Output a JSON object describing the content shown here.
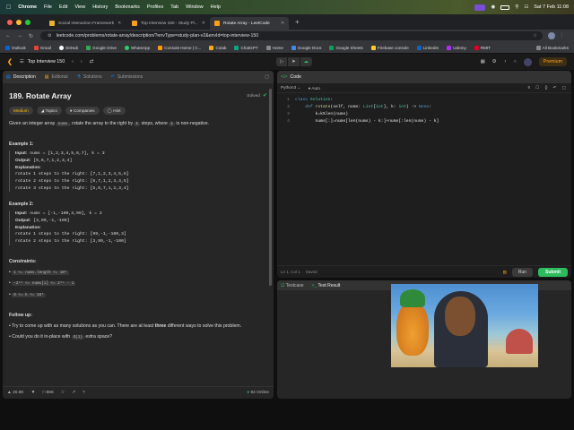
{
  "macos": {
    "menu": [
      "Chrome",
      "File",
      "Edit",
      "View",
      "History",
      "Bookmarks",
      "Profiles",
      "Tab",
      "Window",
      "Help"
    ],
    "datetime": "Sat 7 Feb  11:08"
  },
  "tabs": [
    {
      "label": "Social Interaction Framework",
      "color": "#e8b030"
    },
    {
      "label": "Top Interview 150 - Study Pl...",
      "color": "#f89f1b"
    },
    {
      "label": "Rotate Array - LeetCode",
      "color": "#f89f1b"
    }
  ],
  "address": {
    "url": "leetcode.com/problems/rotate-array/description/?envType=study-plan-v2&envId=top-interview-150"
  },
  "bookmarks": [
    {
      "label": "Outlook",
      "color": "#0a64d6"
    },
    {
      "label": "Gmail",
      "color": "#ea4335"
    },
    {
      "label": "GitHub",
      "color": "#ffffff"
    },
    {
      "label": "Google Drive",
      "color": "#34a853"
    },
    {
      "label": "WhatsApp",
      "color": "#25d366"
    },
    {
      "label": "Console Home | C...",
      "color": "#ff9900"
    },
    {
      "label": "Colab",
      "color": "#f9ab00"
    },
    {
      "label": "ChatGPT",
      "color": "#10a37f"
    },
    {
      "label": "Home",
      "color": "#888888"
    },
    {
      "label": "Google Docs",
      "color": "#4285f4"
    },
    {
      "label": "Google Sheets",
      "color": "#0f9d58"
    },
    {
      "label": "Firebase console",
      "color": "#ffca28"
    },
    {
      "label": "LinkedIn",
      "color": "#0a66c2"
    },
    {
      "label": "Udemy",
      "color": "#a435f0"
    },
    {
      "label": "RMIT",
      "color": "#e60028"
    }
  ],
  "all_bookmarks": "All Bookmarks",
  "lc": {
    "list_title": "Top Interview 150",
    "premium": "Premium"
  },
  "left_tabs": [
    "Description",
    "Editorial",
    "Solutions",
    "Submissions"
  ],
  "problem": {
    "title": "189. Rotate Array",
    "status": "Solved",
    "chips": [
      "Medium",
      "Topics",
      "Companies",
      "Hint"
    ],
    "stmt_a": "Given an integer array ",
    "stmt_b": "nums",
    "stmt_c": ", rotate the array to the right by ",
    "stmt_d": "k",
    "stmt_e": " steps, where ",
    "stmt_f": "k",
    "stmt_g": " is non-negative."
  },
  "ex1": {
    "h": "Example 1:",
    "lines": [
      [
        "Input:",
        " nums = [1,2,3,4,5,6,7], k = 3"
      ],
      [
        "Output:",
        " [5,6,7,1,2,3,4]"
      ],
      [
        "Explanation:",
        ""
      ],
      [
        "",
        "rotate 1 steps to the right: [7,1,2,3,4,5,6]"
      ],
      [
        "",
        "rotate 2 steps to the right: [6,7,1,2,3,4,5]"
      ],
      [
        "",
        "rotate 3 steps to the right: [5,6,7,1,2,3,4]"
      ]
    ]
  },
  "ex2": {
    "h": "Example 2:",
    "lines": [
      [
        "Input:",
        " nums = [-1,-100,3,99], k = 2"
      ],
      [
        "Output:",
        " [3,99,-1,-100]"
      ],
      [
        "Explanation:",
        ""
      ],
      [
        "",
        "rotate 1 steps to the right: [99,-1,-100,3]"
      ],
      [
        "",
        "rotate 2 steps to the right: [3,99,-1,-100]"
      ]
    ]
  },
  "constraints": {
    "h": "Constraints:",
    "items": [
      "1 <= nums.length <= 10⁵",
      "-2³¹ <= nums[i] <= 2³¹ - 1",
      "0 <= k <= 10⁵"
    ]
  },
  "followup": {
    "h": "Follow up:",
    "i1a": "Try to come up with as many solutions as you can. There are at least ",
    "i1b": "three",
    "i1c": " different ways to solve this problem.",
    "i2a": "Could you do it in-place with ",
    "i2b": "O(1)",
    "i2c": " extra space?"
  },
  "footer": {
    "likes": "20.6K",
    "comments": "666",
    "online": "84 Online"
  },
  "editor": {
    "tab": "Code",
    "lang": "Python3",
    "auto": "Auto",
    "status": "Ln 1, Col 1",
    "saved": "Saved",
    "run": "Run",
    "submit": "Submit"
  },
  "code": [
    [
      "1",
      [
        [
          "kw",
          "class "
        ],
        [
          "ty",
          "Solution"
        ],
        [
          "",
          "​:"
        ]
      ]
    ],
    [
      "2",
      [
        [
          "",
          "    "
        ],
        [
          "kw",
          "def "
        ],
        [
          "fn",
          "rotate"
        ],
        [
          "",
          "(self, nums: "
        ],
        [
          "ty",
          "List"
        ],
        [
          "",
          "["
        ],
        [
          "ty",
          "int"
        ],
        [
          "",
          "], k: "
        ],
        [
          "ty",
          "int"
        ],
        [
          "",
          ") -> "
        ],
        [
          "kw",
          "None"
        ],
        [
          "",
          ":"
        ]
      ]
    ],
    [
      "3",
      [
        [
          "",
          "        k=k%len(nums)"
        ]
      ]
    ],
    [
      "4",
      [
        [
          "",
          "        nums[:]=nums[len(nums) - k:]+nums[:len(nums) - k]"
        ]
      ]
    ]
  ],
  "bottom_tabs": [
    "Testcase",
    "Test Result"
  ],
  "colors": {
    "accent": "#ffa116",
    "green": "#2cbb5d",
    "blue": "#0a84ff"
  }
}
